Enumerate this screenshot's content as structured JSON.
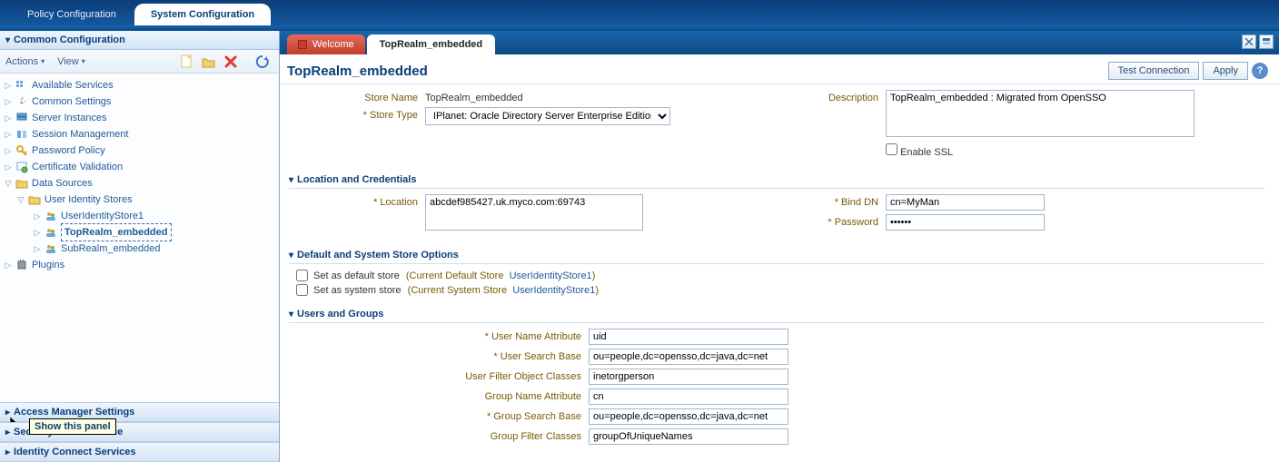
{
  "topTabs": {
    "policy": "Policy Configuration",
    "system": "System Configuration"
  },
  "sidebar": {
    "panels": {
      "common": "Common Configuration",
      "access": "Access Manager Settings",
      "sts": "Security Token Service",
      "idconnect": "Identity Connect Services"
    },
    "toolbar": {
      "actions": "Actions",
      "view": "View"
    },
    "tree": {
      "availableServices": "Available Services",
      "commonSettings": "Common Settings",
      "serverInstances": "Server Instances",
      "sessionManagement": "Session Management",
      "passwordPolicy": "Password Policy",
      "certificateValidation": "Certificate Validation",
      "dataSources": "Data Sources",
      "userIdentityStores": "User Identity Stores",
      "uis1": "UserIdentityStore1",
      "topRealm": "TopRealm_embedded",
      "subRealm": "SubRealm_embedded",
      "plugins": "Plugins"
    },
    "tooltip": "Show this panel"
  },
  "innerTabs": {
    "welcome": "Welcome",
    "current": "TopRealm_embedded"
  },
  "page": {
    "heading": "TopRealm_embedded",
    "buttons": {
      "test": "Test Connection",
      "apply": "Apply"
    },
    "fields": {
      "storeNameLabel": "Store Name",
      "storeName": "TopRealm_embedded",
      "storeTypeLabel": "Store Type",
      "storeType": "IPlanet: Oracle Directory Server Enterprise Edition",
      "descriptionLabel": "Description",
      "description": "TopRealm_embedded : Migrated from OpenSSO",
      "enableSSL": "Enable SSL"
    },
    "sections": {
      "location": "Location and Credentials",
      "defaults": "Default and System Store Options",
      "usersGroups": "Users and Groups"
    },
    "location": {
      "locationLabel": "Location",
      "location": "abcdef985427.uk.myco.com:69743",
      "bindDnLabel": "Bind DN",
      "bindDn": "cn=MyMan",
      "passwordLabel": "Password",
      "password": "••••••"
    },
    "defaults": {
      "defaultStore": "Set as default store",
      "defaultHint": "Current Default Store",
      "defaultVal": "UserIdentityStore1",
      "systemStore": "Set as system store",
      "systemHint": "Current System Store",
      "systemVal": "UserIdentityStore1"
    },
    "usersGroups": {
      "userNameAttrLabel": "User Name Attribute",
      "userNameAttr": "uid",
      "userSearchBaseLabel": "User Search Base",
      "userSearchBase": "ou=people,dc=opensso,dc=java,dc=net",
      "userFilterLabel": "User Filter Object Classes",
      "userFilter": "inetorgperson",
      "groupNameAttrLabel": "Group Name Attribute",
      "groupNameAttr": "cn",
      "groupSearchBaseLabel": "Group Search Base",
      "groupSearchBase": "ou=people,dc=opensso,dc=java,dc=net",
      "groupFilterLabel": "Group Filter Classes",
      "groupFilter": "groupOfUniqueNames"
    }
  }
}
